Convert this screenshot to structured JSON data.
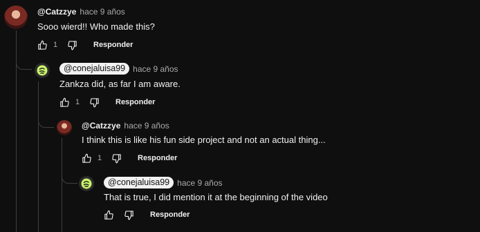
{
  "comments": [
    {
      "author": "@Catzzye",
      "time": "hace 9 años",
      "text": "Sooo wierd!! Who made this?",
      "likes": "1",
      "reply_label": "Responder",
      "avatar_icon": "user-avatar-catzzye"
    },
    {
      "author": "@conejaluisa99",
      "time": "hace 9 años",
      "text": "Zankza did, as far I am aware.",
      "likes": "1",
      "reply_label": "Responder",
      "avatar_icon": "channel-owner-avatar"
    },
    {
      "author": "@Catzzye",
      "time": "hace 9 años",
      "text": "I think this is like his fun side project and not an actual thing...",
      "likes": "1",
      "reply_label": "Responder",
      "avatar_icon": "user-avatar-catzzye"
    },
    {
      "author": "@conejaluisa99",
      "time": "hace 9 años",
      "text": "That is true, I did mention it at the beginning of the video",
      "likes": "",
      "reply_label": "Responder",
      "avatar_icon": "channel-owner-avatar"
    }
  ],
  "icons": {
    "like": "thumbs-up-icon",
    "dislike": "thumbs-down-icon",
    "logo_color": "#c9f36b"
  }
}
